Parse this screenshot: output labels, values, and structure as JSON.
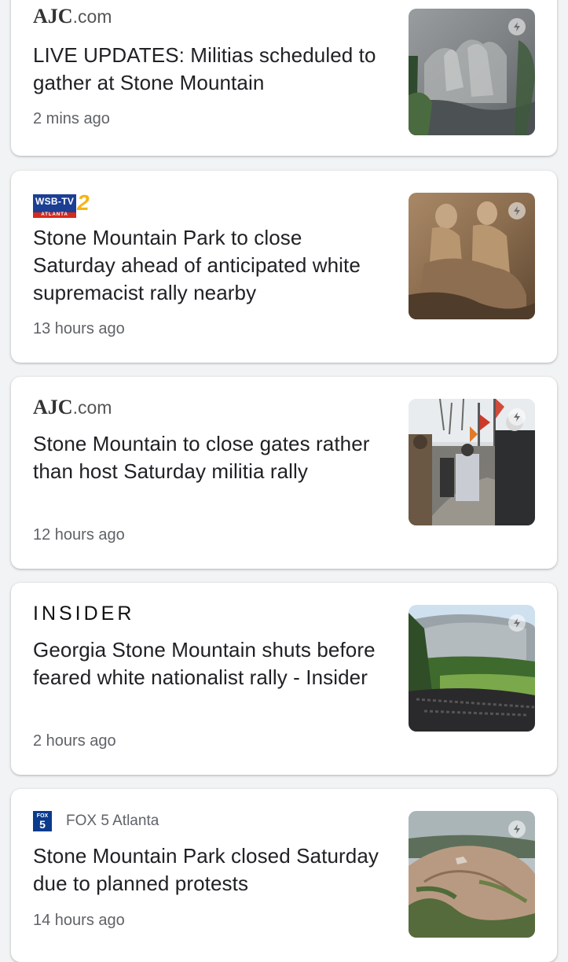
{
  "articles": [
    {
      "source": {
        "name": "AJC",
        "suffix": ".com"
      },
      "headline": "LIVE UPDATES: Militias scheduled to gather at Stone Mountain",
      "time": "2 mins ago",
      "thumbnail_icon": "amp-lightning-icon"
    },
    {
      "source": {
        "name": "WSB-TV",
        "sub": "ATLANTA",
        "number": "2"
      },
      "headline": "Stone Mountain Park to close Saturday ahead of anticipated white supremacist rally nearby",
      "time": "13 hours ago",
      "thumbnail_icon": "amp-lightning-icon"
    },
    {
      "source": {
        "name": "AJC",
        "suffix": ".com"
      },
      "headline": "Stone Mountain to close gates rather than host Saturday militia rally",
      "time": "12 hours ago",
      "thumbnail_icon": "amp-lightning-icon"
    },
    {
      "source": {
        "name": "INSIDER"
      },
      "headline": "Georgia Stone Mountain shuts before feared white nationalist rally - Insider",
      "time": "2 hours ago",
      "thumbnail_icon": "amp-lightning-icon"
    },
    {
      "source": {
        "logo_top": "FOX",
        "logo_num": "5",
        "name": "FOX 5 Atlanta"
      },
      "headline": "Stone Mountain Park closed Saturday due to planned protests",
      "time": "14 hours ago",
      "thumbnail_icon": "amp-lightning-icon"
    }
  ],
  "colors": {
    "background": "#f1f3f4",
    "card": "#ffffff",
    "headline": "#202124",
    "meta": "#5f6368",
    "wsb_blue": "#1c3f94",
    "wsb_gold": "#f3b514",
    "fox_blue": "#0b3b8c"
  }
}
